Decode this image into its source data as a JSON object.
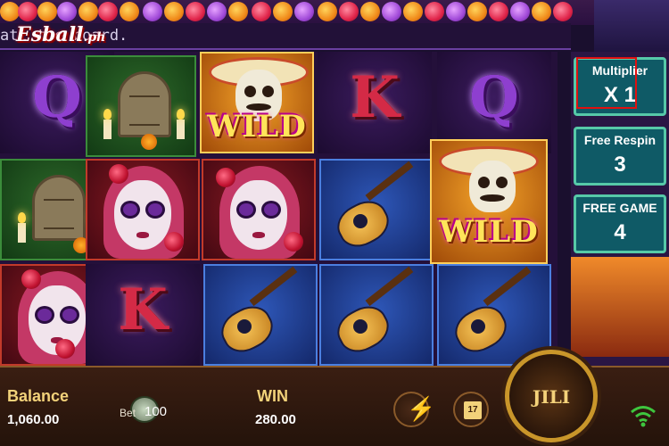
{
  "message_bar": {
    "text": "ati        the board."
  },
  "logo": {
    "text": "Esball",
    "suffix": ".ph"
  },
  "reels": {
    "columns": [
      [
        "Q",
        "tombstone",
        "catrina"
      ],
      [
        "tombstone",
        "catrina",
        "K"
      ],
      [
        "WILD",
        "catrina",
        "guitar"
      ],
      [
        "K",
        "guitar",
        "guitar"
      ],
      [
        "Q",
        "WILD",
        "guitar"
      ]
    ],
    "wild_label": "WILD"
  },
  "side_panels": {
    "multiplier": {
      "label": "Multiplier",
      "value": "X 1"
    },
    "free_respin": {
      "label": "Free Respin",
      "value": "3"
    },
    "free_game": {
      "label": "FREE GAME",
      "value": "4"
    }
  },
  "bottom_bar": {
    "balance_label": "Balance",
    "balance_value": "1,060.00",
    "bet_label": "Bet",
    "bet_value": "100",
    "win_label": "WIN",
    "win_value": "280.00",
    "calendar_value": "17",
    "spin_label": "JILI"
  },
  "colors": {
    "panel_bg": "#0f5a66",
    "panel_border": "#56c9a8",
    "highlight": "#e01010",
    "wild_text": "#ffe45a"
  },
  "icons": [
    "flash-icon",
    "calendar-icon",
    "chips-icon",
    "wifi-icon",
    "spin-icon"
  ]
}
